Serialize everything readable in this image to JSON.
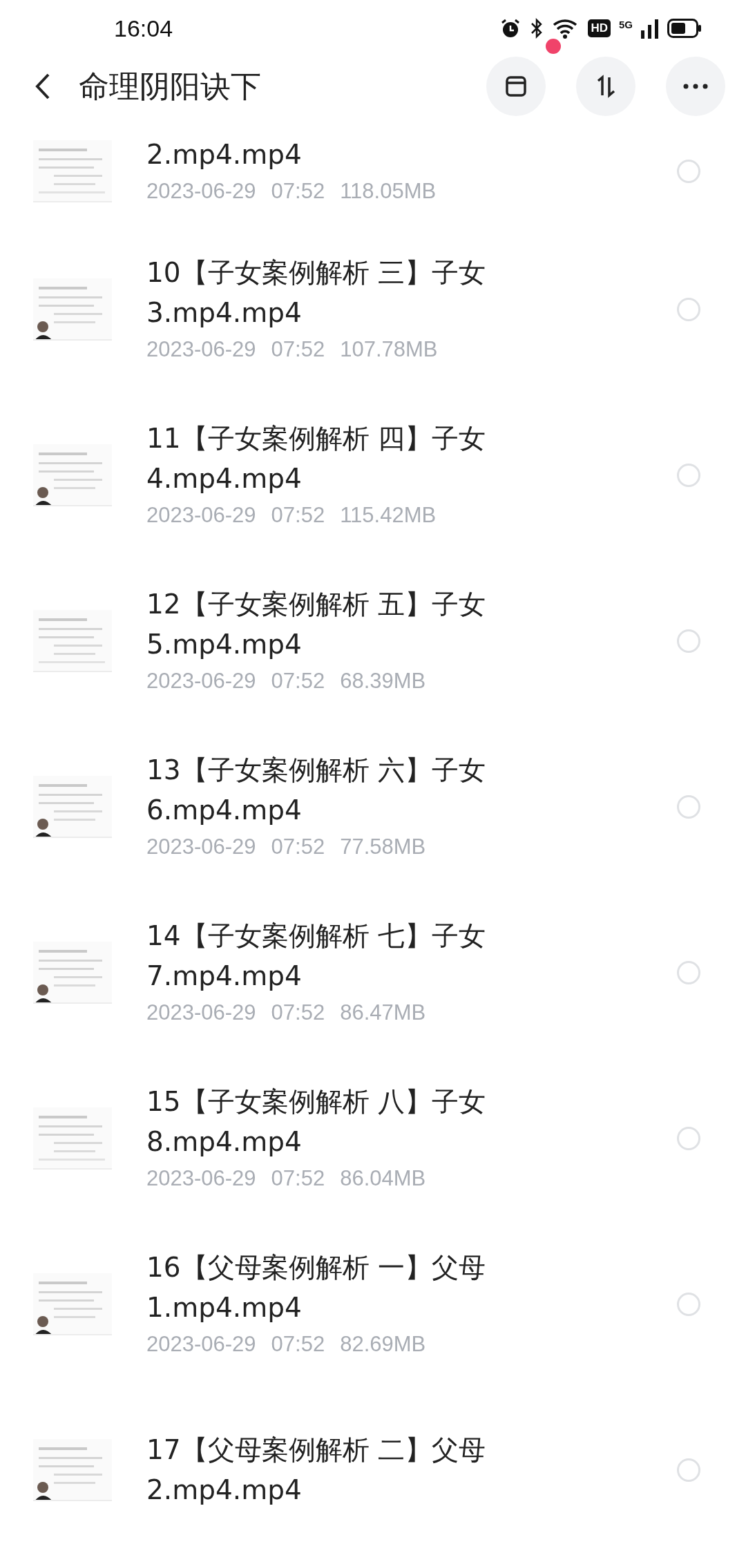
{
  "status_bar": {
    "time": "16:04",
    "hd_badge": "HD",
    "network": "5G"
  },
  "header": {
    "title": "命理阴阳诀下",
    "notification_dot": true
  },
  "files": [
    {
      "title_lines": [
        "2.mp4.mp4"
      ],
      "date": "2023-06-29",
      "time": "07:52",
      "size": "118.05MB",
      "selected": false,
      "kind": "picture"
    },
    {
      "title_lines": [
        "10【子女案例解析 三】子女",
        "3.mp4.mp4"
      ],
      "date": "2023-06-29",
      "time": "07:52",
      "size": "107.78MB",
      "selected": false,
      "kind": "picture"
    },
    {
      "title_lines": [
        "11【子女案例解析 四】子女",
        "4.mp4.mp4"
      ],
      "date": "2023-06-29",
      "time": "07:52",
      "size": "115.42MB",
      "selected": false,
      "kind": "picture"
    },
    {
      "title_lines": [
        "12【子女案例解析 五】子女",
        "5.mp4.mp4"
      ],
      "date": "2023-06-29",
      "time": "07:52",
      "size": "68.39MB",
      "selected": false,
      "kind": "picture"
    },
    {
      "title_lines": [
        "13【子女案例解析 六】子女",
        "6.mp4.mp4"
      ],
      "date": "2023-06-29",
      "time": "07:52",
      "size": "77.58MB",
      "selected": false,
      "kind": "picture"
    },
    {
      "title_lines": [
        "14【子女案例解析 七】子女",
        "7.mp4.mp4"
      ],
      "date": "2023-06-29",
      "time": "07:52",
      "size": "86.47MB",
      "selected": false,
      "kind": "picture"
    },
    {
      "title_lines": [
        "15【子女案例解析 八】子女",
        "8.mp4.mp4"
      ],
      "date": "2023-06-29",
      "time": "07:52",
      "size": "86.04MB",
      "selected": false,
      "kind": "picture"
    },
    {
      "title_lines": [
        "16【父母案例解析 一】父母",
        "1.mp4.mp4"
      ],
      "date": "2023-06-29",
      "time": "07:52",
      "size": "82.69MB",
      "selected": false,
      "kind": "picture"
    },
    {
      "title_lines": [
        "17【父母案例解析 二】父母",
        "2.mp4.mp4"
      ],
      "selected": false,
      "kind": "picture"
    }
  ]
}
